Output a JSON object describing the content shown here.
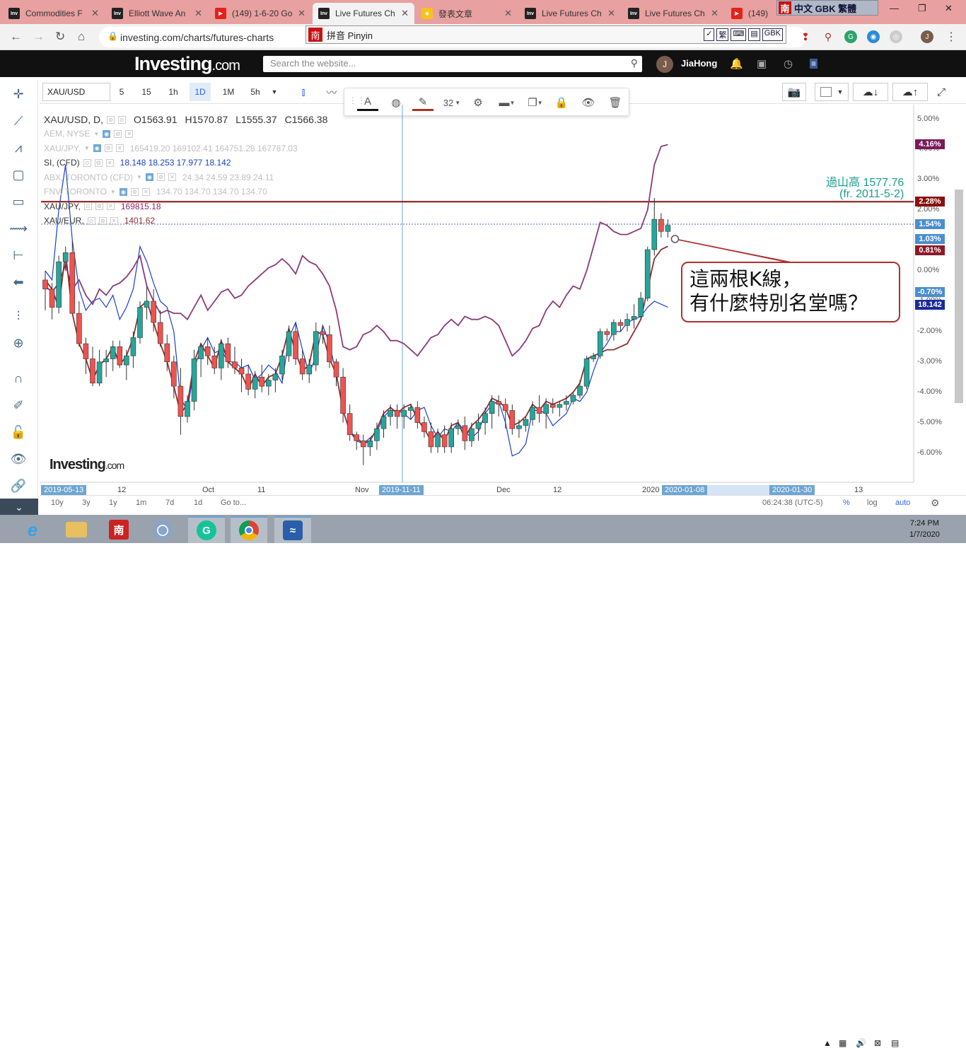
{
  "browser": {
    "tabs": [
      {
        "icon": "investing-favicon",
        "title": "Commodities F"
      },
      {
        "icon": "investing-favicon",
        "title": "Elliott Wave An"
      },
      {
        "icon": "youtube-favicon",
        "title": "(149) 1-6-20 Go"
      },
      {
        "icon": "investing-favicon",
        "title": "Live Futures Ch",
        "active": true
      },
      {
        "icon": "gem-favicon",
        "title": "發表文章"
      },
      {
        "icon": "investing-favicon",
        "title": "Live Futures Ch"
      },
      {
        "icon": "investing-favicon",
        "title": "Live Futures Ch"
      },
      {
        "icon": "youtube-favicon",
        "title": "(149)"
      }
    ],
    "url": "investing.com/charts/futures-charts",
    "ime_bar": {
      "badge": "南",
      "text": "中文 GBK 繁體"
    },
    "pinyin_bar": {
      "badge": "南",
      "text": "拼音 Pinyin",
      "tools": [
        "✓",
        "繁",
        "⌨",
        "▤",
        "GBK"
      ]
    }
  },
  "site": {
    "logo": "Investing",
    "logo_suffix": ".com",
    "search_placeholder": "Search the website...",
    "user_initial": "J",
    "username": "JiaHong"
  },
  "toolbar": {
    "symbol": "XAU/USD",
    "intervals": [
      "5",
      "15",
      "1h",
      "1D",
      "1M",
      "5h"
    ],
    "selected_interval": "1D",
    "drawing_font_size": "32"
  },
  "legend": {
    "main": {
      "symbol": "XAU/USD, D,",
      "o": "O1563.91",
      "h": "H1570.87",
      "l": "L1555.37",
      "c": "C1566.38"
    },
    "overlays": [
      {
        "name": "AEM, NYSE",
        "values": "",
        "faded": true,
        "eye": true
      },
      {
        "name": "XAU/JPY,",
        "values": "165419.20   169102.41   164751.28   167787.03",
        "faded": true,
        "eye": true
      },
      {
        "name": "SI, (CFD)",
        "values": "18.148   18.253   17.977   18.142",
        "faded": false,
        "eye": false,
        "color": "#1a3fd0"
      },
      {
        "name": "ABX, TORONTO (CFD)",
        "values": "24.34   24.59   23.89   24.11",
        "faded": true,
        "eye": true
      },
      {
        "name": "FNV, TORONTO",
        "values": "134.70   134.70   134.70   134.70",
        "faded": true,
        "eye": true
      },
      {
        "name": "XAU/JPY,",
        "values": "169815.18",
        "faded": false,
        "eye": false,
        "color": "#8b2a6a"
      },
      {
        "name": "XAU/EUR,",
        "values": "1401.62",
        "faded": false,
        "eye": false,
        "color": "#8b3030"
      }
    ]
  },
  "y_axis": {
    "labels": [
      "5.00%",
      "4.00%",
      "3.00%",
      "2.00%",
      "1.00%",
      "0.00%",
      "-1.00%",
      "-2.00%",
      "-3.00%",
      "-4.00%",
      "-5.00%",
      "-6.00%"
    ],
    "badges": [
      {
        "text": "4.16%",
        "color": "#7a1a5a"
      },
      {
        "text": "2.28%",
        "color": "#8b1010"
      },
      {
        "text": "1.54%",
        "color": "#4a8ed0"
      },
      {
        "text": "1.03%",
        "color": "#4a8ed0"
      },
      {
        "text": "0.81%",
        "color": "#8b1a2a"
      },
      {
        "text": "-0.70%",
        "color": "#4a8ed0"
      },
      {
        "text": "18.142",
        "color": "#1a2a9a"
      }
    ]
  },
  "annotations": {
    "high_label_line1": "過山高 1577.76",
    "high_label_line2": "(fr. 2011-5-2)",
    "callout_line1": "這兩根K線，",
    "callout_line2": "有什麼特別名堂嗎？"
  },
  "x_axis": {
    "labels": [
      "2019-05-13",
      "12",
      "Oct",
      "11",
      "Nov",
      "2019-11-11",
      "Dec",
      "12",
      "2020",
      "2020-01-08",
      "2020-01-30",
      "13"
    ],
    "highlighted": [
      "2019-05-13",
      "2019-11-11",
      "2020-01-08",
      "2020-01-30"
    ]
  },
  "bottom_bar": {
    "ranges": [
      "10y",
      "3y",
      "1y",
      "1m",
      "7d",
      "1d",
      "Go to..."
    ],
    "time": "06:24:38 (UTC-5)",
    "percent": "%",
    "log": "log",
    "auto": "auto"
  },
  "watermark": {
    "logo": "Investing",
    "suffix": ".com"
  },
  "taskbar": {
    "time": "7:24 PM",
    "date": "1/7/2020"
  },
  "chart_data": {
    "type": "line",
    "title": "XAU/USD, D,",
    "ylabel": "%",
    "ylim": [
      -6.5,
      5.3
    ],
    "grid": false,
    "reference_line_pct": 2.28,
    "reference_line_label": "過山高 1577.76",
    "current_line_pct": 1.54,
    "series": [
      {
        "name": "XAU/USD",
        "type": "candlestick",
        "color_up": "#26a69a",
        "color_down": "#ef5350",
        "candles": [
          [
            -0.3,
            0.0,
            -1.3,
            -0.6
          ],
          [
            -0.6,
            -0.4,
            -1.6,
            -1.2
          ],
          [
            -1.2,
            0.5,
            -1.4,
            0.3
          ],
          [
            0.3,
            0.8,
            0.0,
            0.6
          ],
          [
            0.6,
            1.0,
            -0.8,
            -1.4
          ],
          [
            -1.4,
            -1.0,
            -2.5,
            -2.4
          ],
          [
            -2.4,
            -2.2,
            -3.4,
            -2.9
          ],
          [
            -2.9,
            -2.5,
            -3.8,
            -3.7
          ],
          [
            -3.7,
            -2.6,
            -3.8,
            -3.0
          ],
          [
            -3.0,
            -2.6,
            -3.5,
            -2.9
          ],
          [
            -2.9,
            -2.3,
            -3.3,
            -2.5
          ],
          [
            -2.5,
            -2.3,
            -3.2,
            -3.1
          ],
          [
            -3.1,
            -2.6,
            -3.6,
            -2.8
          ],
          [
            -2.8,
            -2.0,
            -3.2,
            -2.2
          ],
          [
            -2.2,
            -1.0,
            -2.4,
            -1.2
          ],
          [
            -1.2,
            -0.5,
            -1.6,
            -1.0
          ],
          [
            -1.0,
            -0.6,
            -2.0,
            -1.7
          ],
          [
            -1.7,
            -1.3,
            -2.5,
            -2.4
          ],
          [
            -2.4,
            -2.1,
            -3.3,
            -3.0
          ],
          [
            -3.0,
            -2.8,
            -4.2,
            -3.8
          ],
          [
            -3.8,
            -3.2,
            -5.4,
            -4.8
          ],
          [
            -4.8,
            -4.1,
            -5.0,
            -4.3
          ],
          [
            -4.3,
            -2.6,
            -4.6,
            -2.9
          ],
          [
            -2.9,
            -2.4,
            -3.5,
            -2.5
          ],
          [
            -2.5,
            -2.2,
            -3.1,
            -2.8
          ],
          [
            -2.8,
            -2.5,
            -3.4,
            -3.2
          ],
          [
            -3.2,
            -2.3,
            -3.6,
            -2.4
          ],
          [
            -2.4,
            -2.2,
            -3.2,
            -3.0
          ],
          [
            -3.0,
            -2.5,
            -3.4,
            -3.2
          ],
          [
            -3.2,
            -2.9,
            -4.0,
            -3.4
          ],
          [
            -3.4,
            -3.1,
            -4.1,
            -3.9
          ],
          [
            -3.9,
            -3.3,
            -4.2,
            -3.5
          ],
          [
            -3.5,
            -3.1,
            -4.0,
            -3.8
          ],
          [
            -3.8,
            -3.4,
            -4.1,
            -3.6
          ],
          [
            -3.6,
            -3.2,
            -4.0,
            -3.4
          ],
          [
            -3.4,
            -2.6,
            -3.6,
            -2.8
          ],
          [
            -2.8,
            -1.8,
            -3.0,
            -2.0
          ],
          [
            -2.0,
            -1.7,
            -3.1,
            -2.9
          ],
          [
            -2.9,
            -2.6,
            -3.6,
            -3.4
          ],
          [
            -3.4,
            -2.9,
            -3.7,
            -3.1
          ],
          [
            -3.1,
            -1.7,
            -3.3,
            -2.0
          ],
          [
            -2.0,
            -1.8,
            -2.4,
            -2.1
          ],
          [
            -2.1,
            -1.8,
            -3.2,
            -3.0
          ],
          [
            -3.0,
            -2.9,
            -3.8,
            -3.5
          ],
          [
            -3.5,
            -3.2,
            -5.0,
            -4.7
          ],
          [
            -4.7,
            -4.4,
            -5.6,
            -5.4
          ],
          [
            -5.4,
            -5.3,
            -5.9,
            -5.6
          ],
          [
            -5.6,
            -5.4,
            -6.4,
            -5.8
          ],
          [
            -5.8,
            -5.5,
            -6.1,
            -5.6
          ],
          [
            -5.6,
            -5.0,
            -5.9,
            -5.2
          ],
          [
            -5.2,
            -4.6,
            -5.5,
            -4.8
          ],
          [
            -4.8,
            -4.4,
            -5.1,
            -4.6
          ],
          [
            -4.6,
            -4.4,
            -5.2,
            -4.8
          ],
          [
            -4.8,
            -4.4,
            -5.2,
            -4.6
          ],
          [
            -4.6,
            -4.4,
            -4.9,
            -4.5
          ],
          [
            -4.5,
            -4.3,
            -5.2,
            -5.0
          ],
          [
            -5.0,
            -4.8,
            -5.5,
            -5.3
          ],
          [
            -5.3,
            -5.0,
            -6.0,
            -5.8
          ],
          [
            -5.8,
            -5.2,
            -6.0,
            -5.4
          ],
          [
            -5.4,
            -5.1,
            -6.0,
            -5.8
          ],
          [
            -5.8,
            -5.0,
            -6.0,
            -5.2
          ],
          [
            -5.2,
            -4.9,
            -5.4,
            -5.1
          ],
          [
            -5.1,
            -4.8,
            -5.9,
            -5.6
          ],
          [
            -5.6,
            -5.0,
            -5.8,
            -5.2
          ],
          [
            -5.2,
            -4.7,
            -5.6,
            -5.0
          ],
          [
            -5.0,
            -4.5,
            -5.4,
            -4.7
          ],
          [
            -4.7,
            -4.1,
            -5.2,
            -4.3
          ],
          [
            -4.3,
            -4.1,
            -4.8,
            -4.4
          ],
          [
            -4.4,
            -4.2,
            -5.2,
            -4.6
          ],
          [
            -4.6,
            -4.4,
            -5.4,
            -5.2
          ],
          [
            -5.2,
            -4.9,
            -5.5,
            -5.1
          ],
          [
            -5.1,
            -4.8,
            -5.3,
            -4.9
          ],
          [
            -4.9,
            -4.3,
            -5.1,
            -4.5
          ],
          [
            -4.5,
            -4.1,
            -5.0,
            -4.7
          ],
          [
            -4.7,
            -4.2,
            -5.2,
            -4.4
          ],
          [
            -4.4,
            -4.2,
            -4.7,
            -4.5
          ],
          [
            -4.5,
            -4.3,
            -4.8,
            -4.4
          ],
          [
            -4.4,
            -4.1,
            -4.6,
            -4.3
          ],
          [
            -4.3,
            -4.0,
            -4.4,
            -4.1
          ],
          [
            -4.1,
            -3.6,
            -4.2,
            -3.8
          ],
          [
            -3.8,
            -2.8,
            -3.9,
            -2.9
          ],
          [
            -2.9,
            -2.7,
            -3.0,
            -2.8
          ],
          [
            -2.8,
            -1.9,
            -2.9,
            -2.0
          ],
          [
            -2.0,
            -1.9,
            -2.3,
            -2.1
          ],
          [
            -2.1,
            -1.6,
            -2.3,
            -1.7
          ],
          [
            -1.7,
            -1.6,
            -2.0,
            -1.8
          ],
          [
            -1.8,
            -1.4,
            -2.0,
            -1.6
          ],
          [
            -1.6,
            -1.1,
            -1.9,
            -1.5
          ],
          [
            -1.5,
            -0.7,
            -1.6,
            -0.9
          ],
          [
            -0.9,
            0.8,
            -1.0,
            0.7
          ],
          [
            0.7,
            2.4,
            0.5,
            1.7
          ],
          [
            1.7,
            1.9,
            1.1,
            1.3
          ],
          [
            1.3,
            1.7,
            1.1,
            1.5
          ]
        ]
      },
      {
        "name": "SI, (CFD)",
        "color": "#1a3fd0",
        "values": [
          0.0,
          -0.3,
          2.0,
          3.5,
          1.0,
          -0.6,
          -1.3,
          -1.0,
          -0.9,
          -1.2,
          -0.8,
          -1.6,
          -1.2,
          -0.6,
          0.8,
          0.3,
          -0.4,
          -1.0,
          -1.2,
          -2.0,
          -4.2,
          -4.6,
          -3.2,
          -2.6,
          -2.2,
          -2.7,
          -2.6,
          -3.0,
          -3.0,
          -3.2,
          -3.1,
          -3.6,
          -3.4,
          -3.1,
          -3.3,
          -3.7,
          -2.2,
          -1.7,
          -2.6,
          -3.4,
          -2.8,
          -1.8,
          -2.4,
          -3.4,
          -4.6,
          -5.3,
          -5.6,
          -5.7,
          -5.5,
          -5.3,
          -4.8,
          -4.6,
          -4.6,
          -4.7,
          -4.9,
          -4.6,
          -4.5,
          -5.1,
          -5.5,
          -5.2,
          -5.3,
          -5.0,
          -5.3,
          -5.5,
          -5.3,
          -4.7,
          -4.4,
          -4.3,
          -5.0,
          -6.1,
          -6.0,
          -5.7,
          -4.6,
          -4.6,
          -4.7,
          -5.1,
          -4.9,
          -4.7,
          -4.2,
          -4.3,
          -4.0,
          -3.3,
          -2.7,
          -2.4,
          -2.0,
          -2.0,
          -1.7,
          -1.6,
          -1.5,
          -1.2,
          -1.0,
          -1.1,
          -1.2
        ]
      },
      {
        "name": "XAU/JPY,",
        "color": "#8b3a7a",
        "values": [
          -0.5,
          -0.7,
          -0.4,
          0.2,
          -0.6,
          -0.3,
          -0.8,
          -1.1,
          -0.6,
          -0.8,
          -0.5,
          -0.4,
          -0.2,
          0.1,
          0.5,
          -0.5,
          -1.0,
          -1.4,
          -1.3,
          -1.4,
          -1.4,
          -1.6,
          -1.2,
          -0.8,
          -1.3,
          -1.0,
          -0.7,
          -0.6,
          -0.9,
          -0.8,
          -0.5,
          -0.3,
          -0.1,
          0.1,
          0.2,
          0.4,
          0.2,
          -0.1,
          0.5,
          0.3,
          0.2,
          -0.1,
          -0.5,
          -1.3,
          -2.5,
          -2.6,
          -2.5,
          -2.1,
          -2.0,
          -1.8,
          -2.0,
          -2.3,
          -2.3,
          -2.4,
          -2.6,
          -2.8,
          -2.5,
          -2.2,
          -2.1,
          -1.8,
          -1.6,
          -1.8,
          -1.5,
          -1.6,
          -1.6,
          -1.5,
          -1.6,
          -1.8,
          -2.3,
          -2.8,
          -2.6,
          -2.3,
          -1.9,
          -1.8,
          -1.3,
          -1.0,
          -1.2,
          -0.8,
          -0.5,
          -0.6,
          0.0,
          0.8,
          1.6,
          1.5,
          1.3,
          1.2,
          1.2,
          1.3,
          1.4,
          2.0,
          3.5,
          4.1,
          4.16
        ]
      },
      {
        "name": "XAU/EUR,",
        "color": "#8b3030",
        "values": [
          -0.3,
          -0.6,
          -1.2,
          0.6,
          -1.4,
          -2.4,
          -2.9,
          -3.6,
          -3.1,
          -2.9,
          -2.5,
          -3.1,
          -2.8,
          -2.2,
          -1.2,
          -1.0,
          -1.7,
          -2.4,
          -3.0,
          -3.8,
          -4.7,
          -4.4,
          -3.0,
          -2.4,
          -2.8,
          -3.2,
          -2.3,
          -3.0,
          -3.2,
          -3.4,
          -3.9,
          -3.4,
          -3.8,
          -3.5,
          -3.4,
          -2.8,
          -1.9,
          -2.7,
          -3.3,
          -3.1,
          -2.0,
          -2.1,
          -2.9,
          -3.4,
          -4.6,
          -5.3,
          -5.5,
          -5.7,
          -5.6,
          -5.2,
          -4.7,
          -4.5,
          -4.7,
          -4.5,
          -4.4,
          -4.9,
          -5.2,
          -5.6,
          -5.3,
          -5.6,
          -5.1,
          -5.0,
          -5.5,
          -5.1,
          -4.9,
          -4.6,
          -4.2,
          -4.3,
          -4.5,
          -5.1,
          -5.0,
          -4.8,
          -4.4,
          -4.6,
          -4.3,
          -4.4,
          -4.3,
          -4.2,
          -4.0,
          -3.7,
          -2.9,
          -2.8,
          -2.7,
          -2.6,
          -2.6,
          -2.5,
          -2.4,
          -2.0,
          -1.6,
          -0.6,
          0.4,
          0.7,
          0.81
        ]
      }
    ]
  }
}
